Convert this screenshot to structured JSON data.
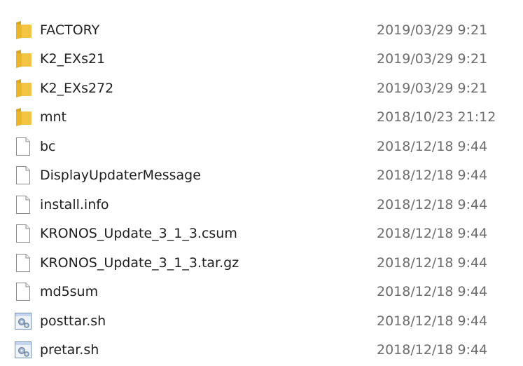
{
  "files": [
    {
      "name": "FACTORY",
      "date": "2019/03/29 9:21",
      "icon": "folder-icon"
    },
    {
      "name": "K2_EXs21",
      "date": "2019/03/29 9:21",
      "icon": "folder-icon"
    },
    {
      "name": "K2_EXs272",
      "date": "2019/03/29 9:21",
      "icon": "folder-icon"
    },
    {
      "name": "mnt",
      "date": "2018/10/23 21:12",
      "icon": "folder-icon"
    },
    {
      "name": "bc",
      "date": "2018/12/18 9:44",
      "icon": "file-icon"
    },
    {
      "name": "DisplayUpdaterMessage",
      "date": "2018/12/18 9:44",
      "icon": "file-icon"
    },
    {
      "name": "install.info",
      "date": "2018/12/18 9:44",
      "icon": "file-icon"
    },
    {
      "name": "KRONOS_Update_3_1_3.csum",
      "date": "2018/12/18 9:44",
      "icon": "file-icon"
    },
    {
      "name": "KRONOS_Update_3_1_3.tar.gz",
      "date": "2018/12/18 9:44",
      "icon": "file-icon"
    },
    {
      "name": "md5sum",
      "date": "2018/12/18 9:44",
      "icon": "file-icon"
    },
    {
      "name": "posttar.sh",
      "date": "2018/12/18 9:44",
      "icon": "script-icon"
    },
    {
      "name": "pretar.sh",
      "date": "2018/12/18 9:44",
      "icon": "script-icon"
    }
  ],
  "colors": {
    "folder_front": "#f4c542",
    "folder_back": "#d9a520",
    "name_text": "#1e1e1e",
    "date_text": "#6d6d6d"
  }
}
